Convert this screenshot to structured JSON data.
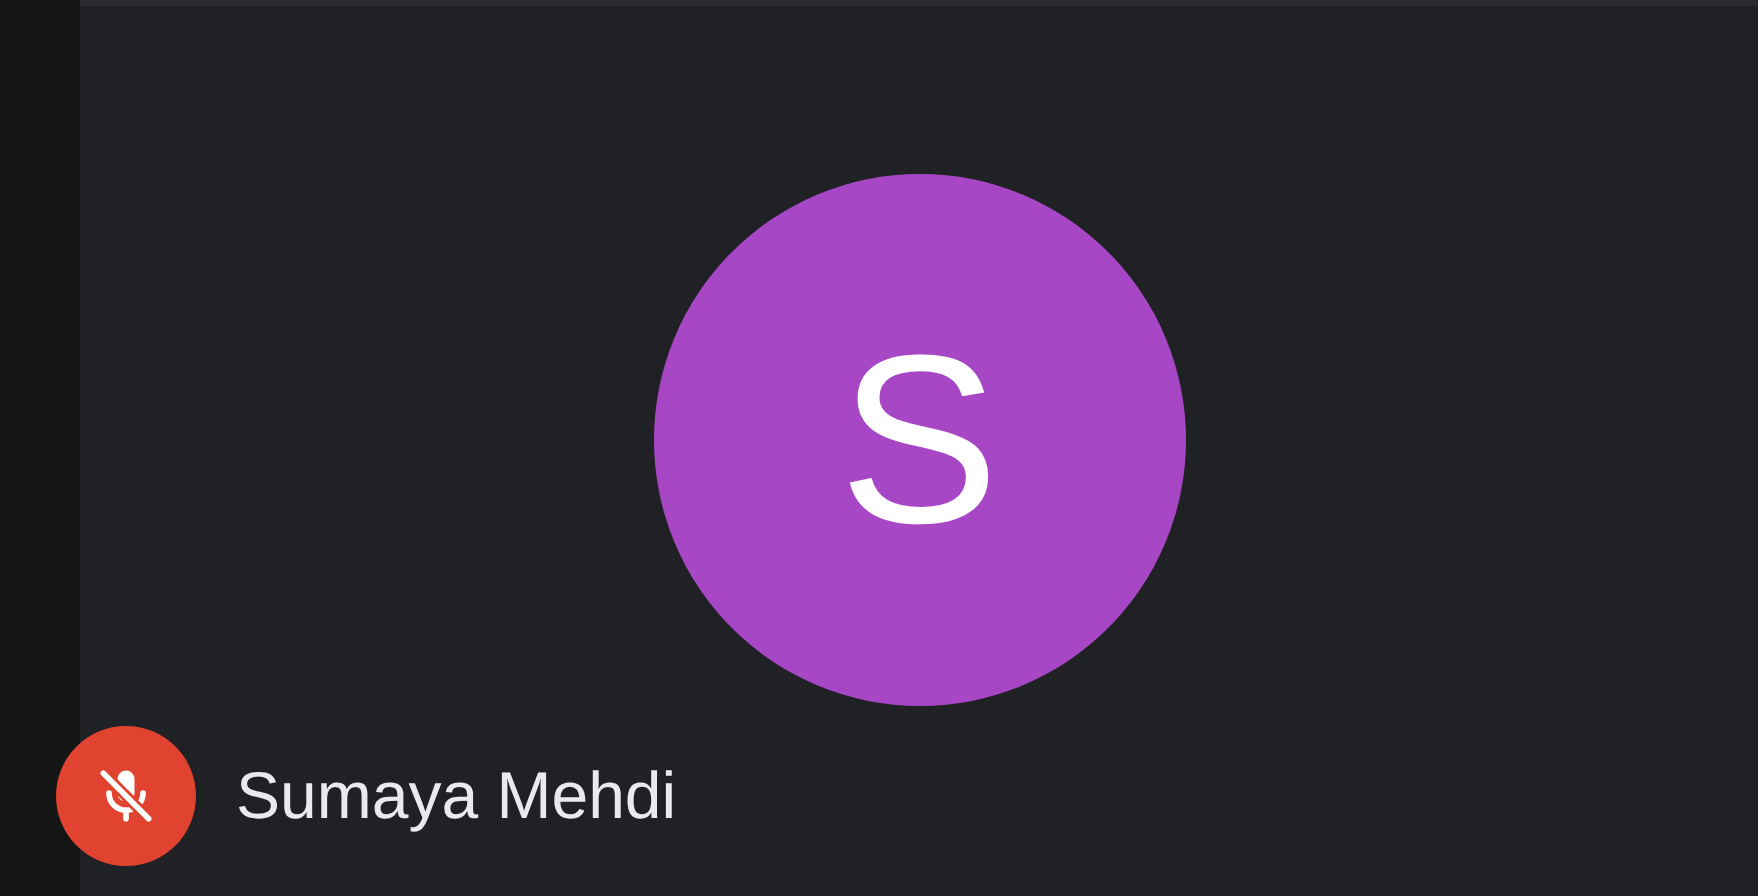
{
  "participant": {
    "initial": "S",
    "name": "Sumaya Mehdi",
    "muted": true
  }
}
